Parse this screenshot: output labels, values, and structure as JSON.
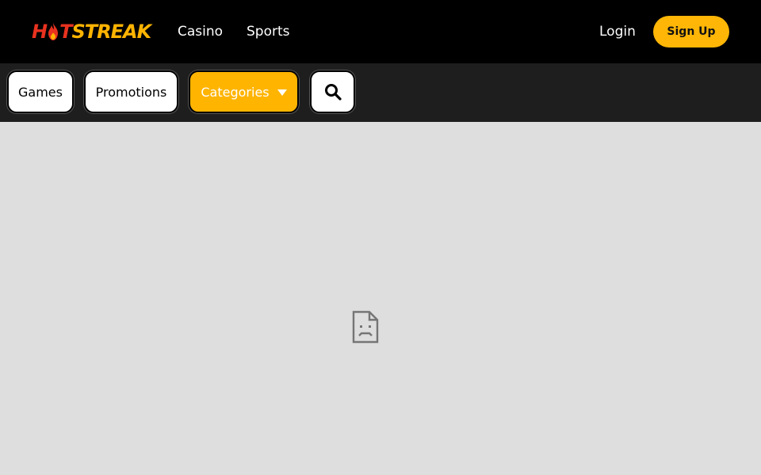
{
  "header": {
    "logo": {
      "part1": "H",
      "part2": "T",
      "part3": "STREAK",
      "flame_icon": "flame-icon"
    },
    "nav": [
      {
        "label": "Casino"
      },
      {
        "label": "Sports"
      }
    ],
    "login_label": "Login",
    "signup_label": "Sign Up"
  },
  "subnav": {
    "games_label": "Games",
    "promotions_label": "Promotions",
    "categories_label": "Categories",
    "categories_icon": "caret-down-icon",
    "search_icon": "search-icon"
  },
  "content": {
    "placeholder_icon": "broken-page-icon"
  },
  "colors": {
    "brand_red": "#e8321f",
    "brand_yellow": "#ffb400",
    "topbar_bg": "#000000",
    "subbar_bg": "#1e1e1e",
    "content_bg": "#dedede"
  }
}
